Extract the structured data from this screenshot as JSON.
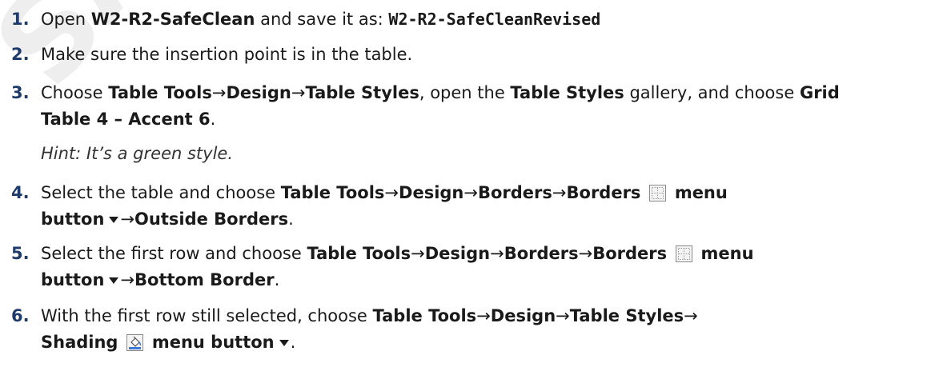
{
  "steps": [
    {
      "num": "1.",
      "t1": "Open ",
      "b1": "W2-R2-SafeClean",
      "t2": " and save it as: ",
      "code1": "W2-R2-SafeCleanRevised"
    },
    {
      "num": "2.",
      "t1": "Make sure the insertion point is in the table."
    },
    {
      "num": "3.",
      "t1": "Choose ",
      "b1": "Table Tools",
      "a1": "→",
      "b2": "Design",
      "a2": "→",
      "b3": "Table Styles",
      "t2": ", open the ",
      "b4": "Table Styles",
      "t3": " gallery, and choose ",
      "b5": "Grid",
      "b6": "Table 4 – Accent 6",
      "t4": ".",
      "hint": "Hint: It’s a green style."
    },
    {
      "num": "4.",
      "t1": "Select the table and choose ",
      "b1": "Table Tools",
      "a1": "→",
      "b2": "Design",
      "a2": "→",
      "b3": "Borders",
      "a3": "→",
      "b4": "Borders",
      "b5": "menu",
      "b6": "button",
      "a4": "→",
      "b7": "Outside Borders",
      "t2": "."
    },
    {
      "num": "5.",
      "t1": "Select the first row and choose ",
      "b1": "Table Tools",
      "a1": "→",
      "b2": "Design",
      "a2": "→",
      "b3": "Borders",
      "a3": "→",
      "b4": "Borders",
      "b5": "menu",
      "b6": "button",
      "a4": "→",
      "b7": "Bottom Border",
      "t2": "."
    },
    {
      "num": "6.",
      "t1": "With the first row still selected, choose ",
      "b1": "Table Tools",
      "a1": "→",
      "b2": "Design",
      "a2": "→",
      "b3": "Table Styles",
      "a3": "→",
      "b4": "Shading",
      "b5": "menu button",
      "t2": "."
    }
  ],
  "icons": {
    "borders": "borders-grid-icon",
    "shading": "paint-bucket-icon",
    "dropdown": "dropdown-caret-icon"
  },
  "colors": {
    "step_number": "#1f3b6a",
    "text": "#1a1a1a",
    "watermark": "#969696"
  }
}
